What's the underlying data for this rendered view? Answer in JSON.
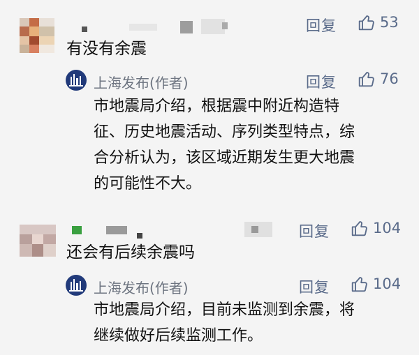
{
  "reply_label": "回复",
  "comments": [
    {
      "text": "有没有余震",
      "likes": "53",
      "reply": {
        "author": "上海发布(作者)",
        "likes": "76",
        "lines": [
          "市地震局介绍，根据震中附近构造特",
          "征、历史地震活动、序列类型特点，综",
          "合分析认为，该区域近期发生更大地震",
          "的可能性不大。"
        ]
      }
    },
    {
      "text": "还会有后续余震吗",
      "likes": "104",
      "reply": {
        "author": "上海发布(作者)",
        "likes": "104",
        "lines": [
          "市地震局介绍，目前未监测到余震，将",
          "继续做好后续监测工作。"
        ]
      }
    }
  ],
  "colors": {
    "link": "#5a6b8a",
    "author": "#6d7480",
    "avatar_bg": "#213a7a"
  },
  "icons": {
    "like": "thumb-up-icon"
  }
}
